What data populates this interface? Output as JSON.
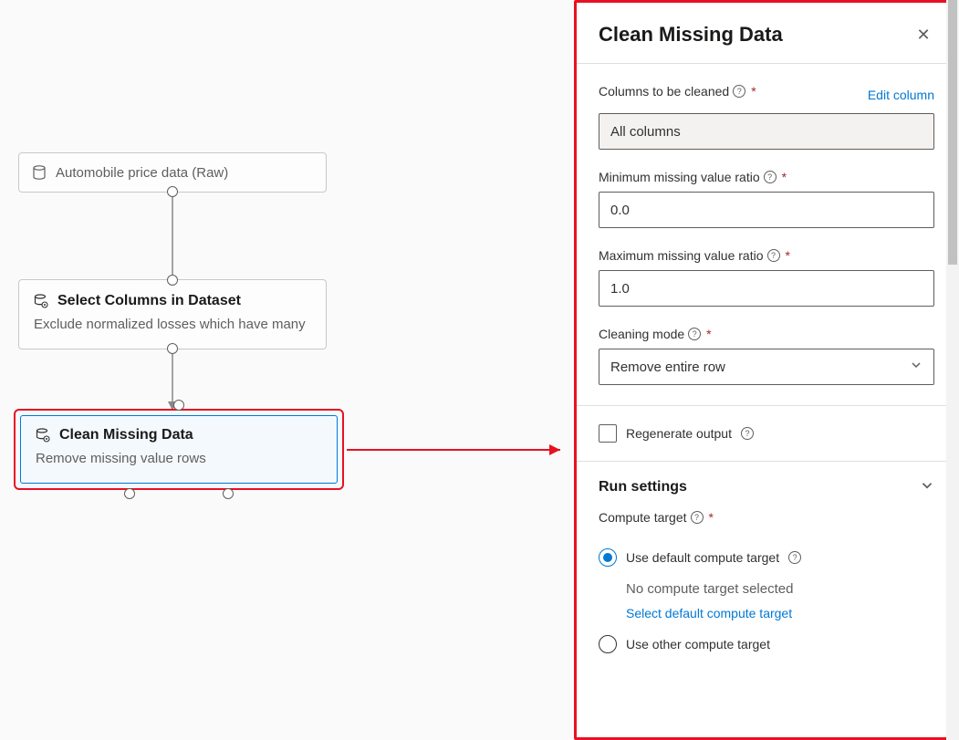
{
  "canvas": {
    "nodes": {
      "dataNode": {
        "label": "Automobile price data (Raw)"
      },
      "selectNode": {
        "title": "Select Columns in Dataset",
        "desc": "Exclude normalized losses which have many"
      },
      "cleanNode": {
        "title": "Clean Missing Data",
        "desc": "Remove missing value rows"
      }
    }
  },
  "panel": {
    "title": "Clean Missing Data",
    "fields": {
      "columnsLabel": "Columns to be cleaned",
      "columnsValue": "All columns",
      "editColumnLink": "Edit column",
      "minRatioLabel": "Minimum missing value ratio",
      "minRatioValue": "0.0",
      "maxRatioLabel": "Maximum missing value ratio",
      "maxRatioValue": "1.0",
      "cleaningModeLabel": "Cleaning mode",
      "cleaningModeValue": "Remove entire row"
    },
    "regenerateLabel": "Regenerate output",
    "runSettings": {
      "title": "Run settings",
      "computeTargetLabel": "Compute target",
      "option1": "Use default compute target",
      "option1Sub": "No compute target selected",
      "option1Link": "Select default compute target",
      "option2": "Use other compute target"
    }
  },
  "glyphs": {
    "required": "*",
    "info": "?",
    "close": "✕",
    "chevronDown": "⌄"
  }
}
